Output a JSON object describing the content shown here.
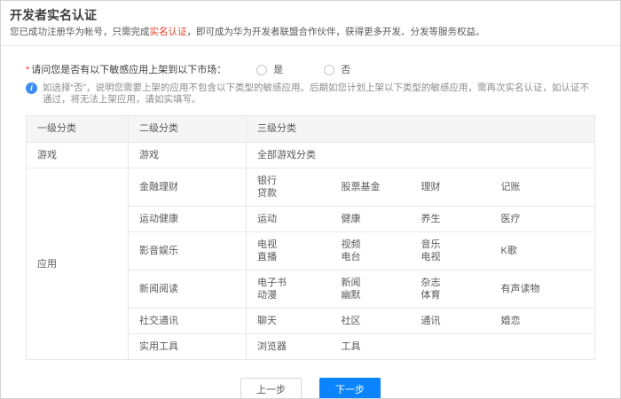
{
  "header": {
    "title": "开发者实名认证",
    "subtitle_prefix": "您已成功注册华为帐号，只需完成",
    "subtitle_link": "实名认证",
    "subtitle_suffix": "，即可成为华为开发者联盟合作伙伴，获得更多开发、分发等服务权益。"
  },
  "question": {
    "required_mark": "*",
    "label": "请问您是否有以下敏感应用上架到以下市场：",
    "option_yes": "是",
    "option_no": "否",
    "hint": "如选择“否”，说明您需要上架的应用不包含以下类型的敏感应用。后期如您计划上架以下类型的敏感应用，需再次实名认证，如认证不通过，将无法上架应用，请如实填写。"
  },
  "table": {
    "headers": [
      "一级分类",
      "二级分类",
      "三级分类"
    ],
    "game": {
      "level1": "游戏",
      "level2": "游戏",
      "level3": "全部游戏分类"
    },
    "app": {
      "level1": "应用",
      "rows": [
        {
          "level2": "金融理财",
          "cells": [
            [
              "银行",
              "贷款"
            ],
            [
              "股票基金"
            ],
            [
              "理财"
            ],
            [
              "记账"
            ]
          ]
        },
        {
          "level2": "运动健康",
          "cells": [
            [
              "运动"
            ],
            [
              "健康"
            ],
            [
              "养生"
            ],
            [
              "医疗"
            ]
          ]
        },
        {
          "level2": "影音娱乐",
          "cells": [
            [
              "电视",
              "直播"
            ],
            [
              "视频",
              "电台"
            ],
            [
              "音乐",
              "电视"
            ],
            [
              "K歌"
            ]
          ]
        },
        {
          "level2": "新闻阅读",
          "cells": [
            [
              "电子书",
              "动漫"
            ],
            [
              "新闻",
              "幽默"
            ],
            [
              "杂志",
              "体育"
            ],
            [
              "有声读物"
            ]
          ]
        },
        {
          "level2": "社交通讯",
          "cells": [
            [
              "聊天"
            ],
            [
              "社区"
            ],
            [
              "通讯"
            ],
            [
              "婚恋"
            ]
          ]
        },
        {
          "level2": "实用工具",
          "cells": [
            [
              "浏览器"
            ],
            [
              "工具"
            ],
            [],
            []
          ]
        }
      ]
    }
  },
  "footer": {
    "prev": "上一步",
    "next": "下一步"
  },
  "colors": {
    "accent_blue": "#0a84ff",
    "link_red": "#e84026",
    "header_bg": "#f5f5f5",
    "border": "#e8e8e8"
  },
  "icons": {
    "info": "info-icon",
    "radio": "radio-circle-icon"
  }
}
